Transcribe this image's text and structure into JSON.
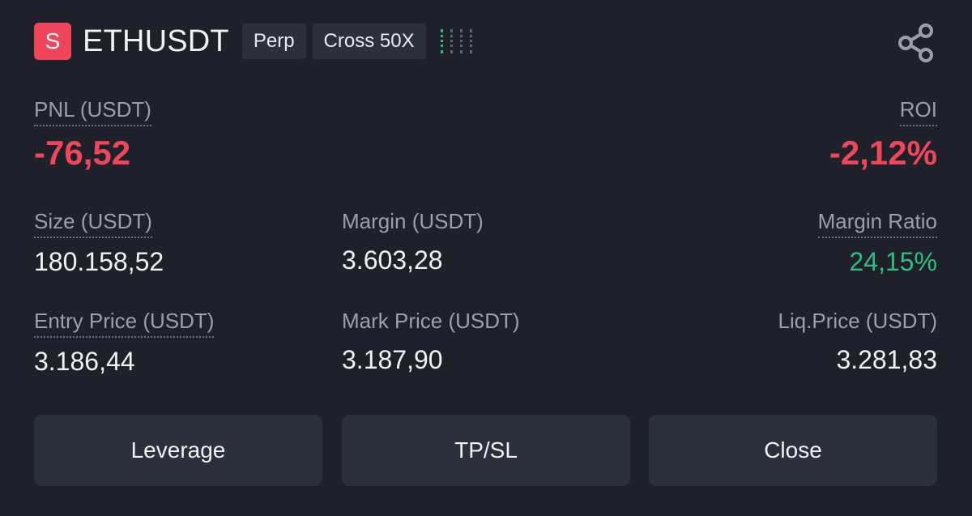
{
  "header": {
    "side_badge": "S",
    "symbol": "ETHUSDT",
    "type_tag": "Perp",
    "margin_tag": "Cross 50X",
    "signal_level": 1,
    "signal_max": 4
  },
  "pnl": {
    "label": "PNL (USDT)",
    "value": "-76,52"
  },
  "roi": {
    "label": "ROI",
    "value": "-2,12%"
  },
  "size": {
    "label": "Size (USDT)",
    "value": "180.158,52"
  },
  "margin": {
    "label": "Margin (USDT)",
    "value": "3.603,28"
  },
  "margin_ratio": {
    "label": "Margin Ratio",
    "value": "24,15%"
  },
  "entry_price": {
    "label": "Entry Price (USDT)",
    "value": "3.186,44"
  },
  "mark_price": {
    "label": "Mark Price (USDT)",
    "value": "3.187,90"
  },
  "liq_price": {
    "label": "Liq.Price (USDT)",
    "value": "3.281,83"
  },
  "buttons": {
    "leverage": "Leverage",
    "tpsl": "TP/SL",
    "close": "Close"
  },
  "colors": {
    "background": "#1e2129",
    "negative": "#f0465b",
    "positive": "#2ebd85",
    "button_bg": "#2c303a"
  },
  "icons": {
    "share": "share-icon"
  }
}
